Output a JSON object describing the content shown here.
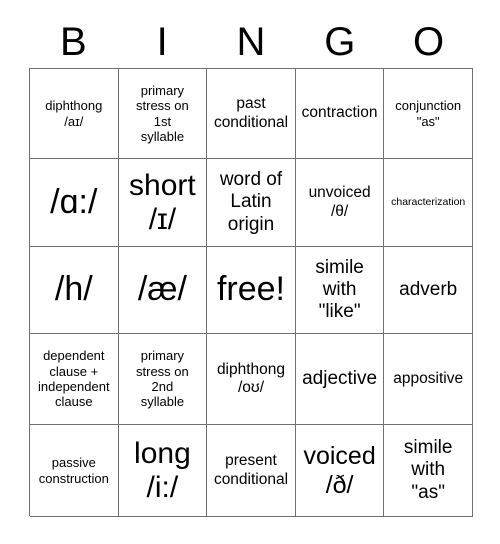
{
  "header": {
    "letters": [
      "B",
      "I",
      "N",
      "G",
      "O"
    ]
  },
  "grid": {
    "columns": 5,
    "rows": 5,
    "border_color": "#6f6f6f",
    "background": "#ffffff",
    "text_color": "#000000",
    "cells": [
      {
        "text": "diphthong\n/aɪ/",
        "size": "sm"
      },
      {
        "text": "primary\nstress on\n1st\nsyllable",
        "size": "sm"
      },
      {
        "text": "past\nconditional",
        "size": "md"
      },
      {
        "text": "contraction",
        "size": "md"
      },
      {
        "text": "conjunction\n\"as\"",
        "size": "sm"
      },
      {
        "text": "/ɑ:/",
        "size": "huge"
      },
      {
        "text": "short\n/ɪ/",
        "size": "xxl"
      },
      {
        "text": "word of\nLatin\norigin",
        "size": "lg"
      },
      {
        "text": "unvoiced\n/θ/",
        "size": "md"
      },
      {
        "text": "characterization",
        "size": "xs"
      },
      {
        "text": "/h/",
        "size": "huge"
      },
      {
        "text": "/æ/",
        "size": "huge"
      },
      {
        "text": "free!",
        "size": "huge"
      },
      {
        "text": "simile\nwith\n\"like\"",
        "size": "lg"
      },
      {
        "text": "adverb",
        "size": "lg"
      },
      {
        "text": "dependent\nclause +\nindependent\nclause",
        "size": "sm"
      },
      {
        "text": "primary\nstress on\n2nd\nsyllable",
        "size": "sm"
      },
      {
        "text": "diphthong\n/oʊ/",
        "size": "md"
      },
      {
        "text": "adjective",
        "size": "lg"
      },
      {
        "text": "appositive",
        "size": "md"
      },
      {
        "text": "passive\nconstruction",
        "size": "sm"
      },
      {
        "text": "long\n/i:/",
        "size": "xxl"
      },
      {
        "text": "present\nconditional",
        "size": "md"
      },
      {
        "text": "voiced\n/ð/",
        "size": "xl"
      },
      {
        "text": "simile\nwith\n\"as\"",
        "size": "lg"
      }
    ]
  }
}
